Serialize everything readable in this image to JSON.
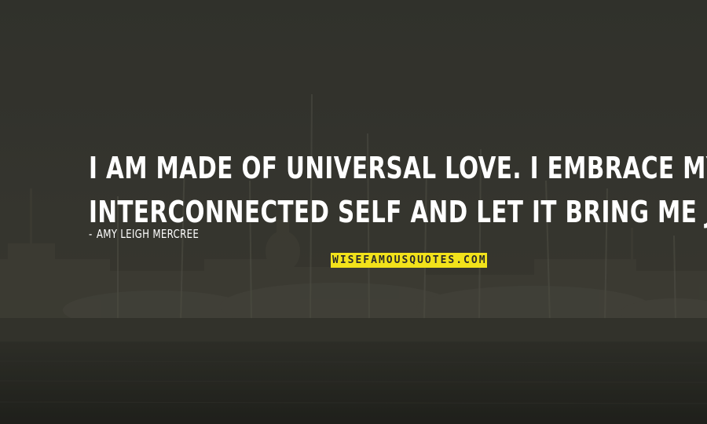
{
  "quote": {
    "lines": [
      "I AM MADE OF UNIVERSAL LOVE. I EMBRACE MY",
      "INTERCONNECTED SELF AND LET IT BRING ME JOY."
    ]
  },
  "author": {
    "dash": "-",
    "name": "AMY LEIGH MERCREE"
  },
  "watermark": {
    "text": "WISEFAMOUSQUOTES.COM"
  },
  "colors": {
    "text": "#ffffff",
    "watermark_bg": "#f2e21b",
    "watermark_text": "#2a2a2a"
  }
}
